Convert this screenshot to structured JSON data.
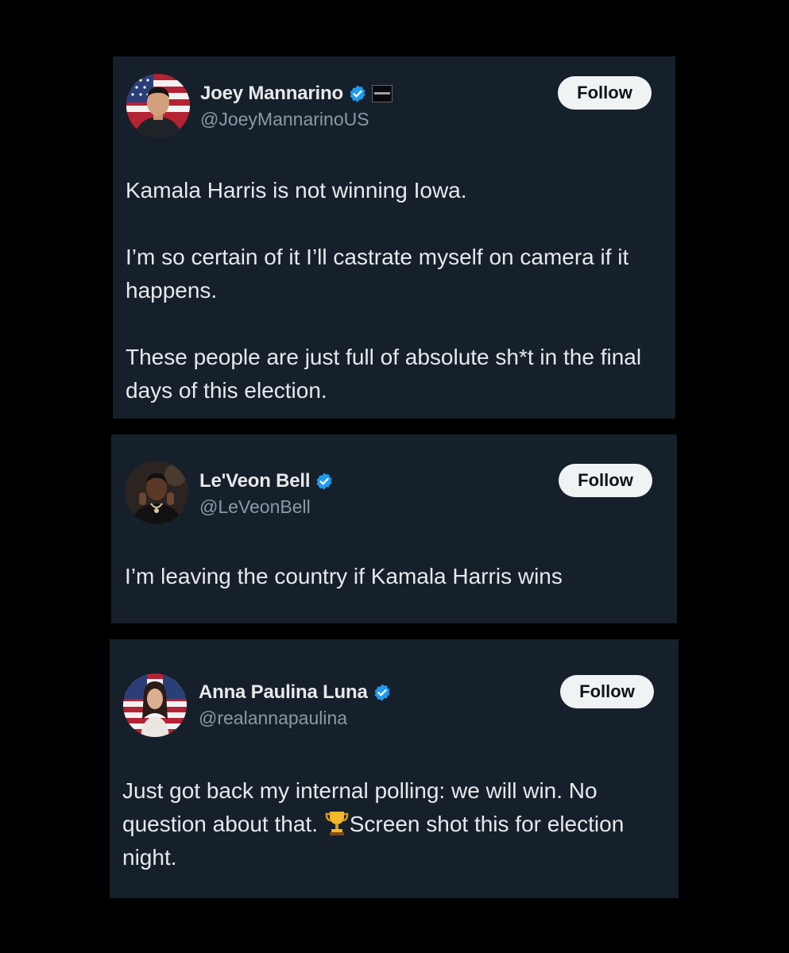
{
  "tweets": [
    {
      "name": "Joey Mannarino",
      "handle": "@JoeyMannarinoUS",
      "verified": true,
      "affiliate_badge": "conservative-badge",
      "follow_label": "Follow",
      "paragraphs": [
        "Kamala Harris is not winning Iowa.",
        "I’m so certain of it I’ll castrate myself on camera if it happens.",
        "These people are just full of absolute sh*t in the final days of this election."
      ]
    },
    {
      "name": "Le'Veon Bell",
      "handle": "@LeVeonBell",
      "verified": true,
      "follow_label": "Follow",
      "paragraphs": [
        "I’m leaving the country if Kamala Harris wins"
      ]
    },
    {
      "name": "Anna Paulina Luna",
      "handle": "@realannapaulina",
      "verified": true,
      "follow_label": "Follow",
      "text_before_emoji": "Just got back my internal polling: we will win. No question about that. ",
      "emoji": "trophy-icon",
      "text_after_emoji": "Screen shot this for election night."
    }
  ],
  "colors": {
    "page_background": "#000000",
    "card_background": "#16202b",
    "text_primary": "#e7e9ea",
    "text_secondary": "#8b98a5",
    "verified_blue": "#1d9bf0",
    "follow_button_bg": "#eff3f4",
    "follow_button_text": "#0f1419"
  }
}
